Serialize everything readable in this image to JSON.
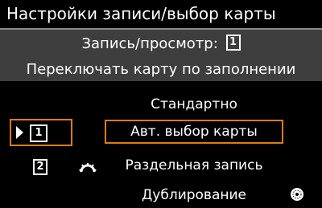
{
  "header": {
    "title": "Настройки записи/выбор карты"
  },
  "info": {
    "record_play_label": "Запись/просмотр:",
    "record_play_card": "1",
    "switch_label": "Переключать карту по заполнении"
  },
  "slots": [
    {
      "number": "1",
      "selected": true
    },
    {
      "number": "2",
      "selected": false
    }
  ],
  "options": [
    {
      "label": "Стандартно"
    },
    {
      "label": "Авт. выбор карты",
      "selected": true
    },
    {
      "label": "Раздельная запись"
    },
    {
      "label": "Дублирование"
    }
  ],
  "icons": {
    "arc": "arc-switch-icon",
    "dial": "control-dial-icon"
  },
  "colors": {
    "accent": "#e07b10",
    "panel": "#3e3e3e",
    "background": "#000000"
  }
}
